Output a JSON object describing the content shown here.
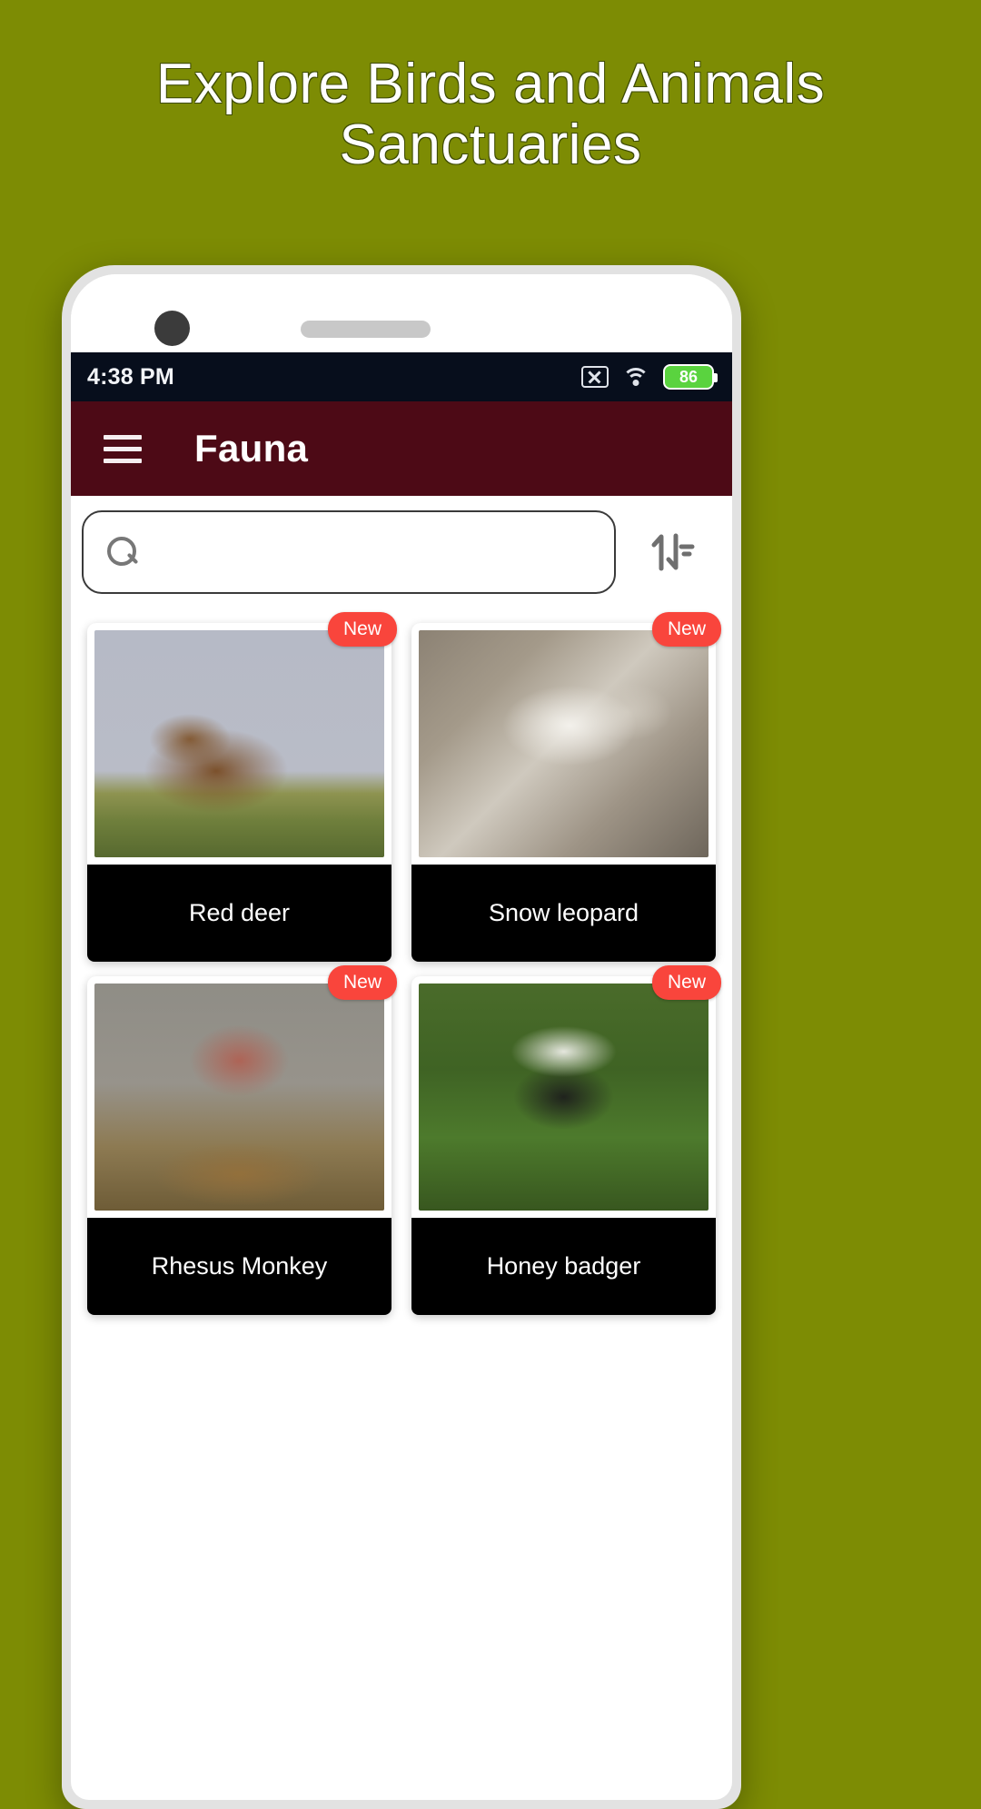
{
  "promo": {
    "line1": "Explore Birds and Animals",
    "line2": "Sanctuaries",
    "background_color": "#7d8c04",
    "text_color": "#ffffff"
  },
  "status_bar": {
    "time": "4:38 PM",
    "background_color": "#070e1c",
    "sim_icon": "sim-no-signal-icon",
    "wifi_icon": "wifi-icon",
    "battery_icon": "battery-icon",
    "battery_level": "86",
    "battery_color": "#5ad33f"
  },
  "app_bar": {
    "menu_icon": "hamburger-menu-icon",
    "title": "Fauna",
    "background_color": "#4d0a16",
    "title_color": "#ffffff"
  },
  "search": {
    "icon": "search-icon",
    "value": "",
    "placeholder": "",
    "sort_icon": "sort-arrows-icon"
  },
  "cards": [
    {
      "name": "Red deer",
      "badge": "New",
      "photo": "photo-deer",
      "photo_alt": "red-deer-stag-on-grassland"
    },
    {
      "name": "Snow leopard",
      "badge": "New",
      "photo": "photo-leopard",
      "photo_alt": "snow-leopard-on-rocks"
    },
    {
      "name": "Rhesus Monkey",
      "badge": "New",
      "photo": "photo-monkey",
      "photo_alt": "rhesus-macaque-portrait"
    },
    {
      "name": "Honey badger",
      "badge": "New",
      "photo": "photo-badger",
      "photo_alt": "honey-badger-walking-on-grass"
    }
  ],
  "colors": {
    "badge_red": "#f9453c",
    "card_label_bg": "#000000",
    "card_label_text": "#ffffff"
  }
}
